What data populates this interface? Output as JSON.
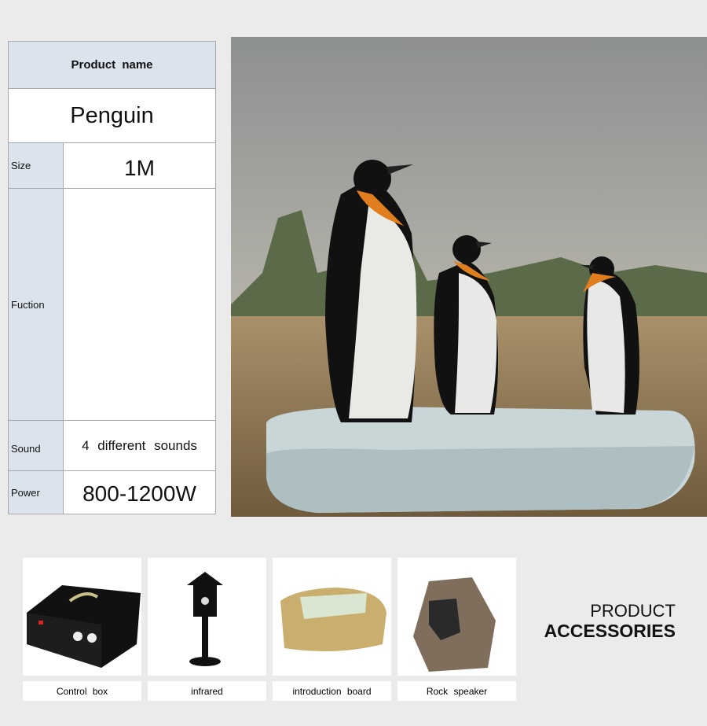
{
  "table": {
    "header": "Product name",
    "name": "Penguin",
    "rows": [
      {
        "label": "Size",
        "value": "1M"
      },
      {
        "label": "Fuction",
        "value": ""
      },
      {
        "label": "Sound",
        "value": "4 different sounds"
      },
      {
        "label": "Power",
        "value": "800-1200W"
      }
    ]
  },
  "accessories": {
    "title_line1": "PRODUCT",
    "title_line2": "ACCESSORIES",
    "items": [
      {
        "label": "Control box"
      },
      {
        "label": "infrared"
      },
      {
        "label": "introduction board"
      },
      {
        "label": "Rock speaker"
      }
    ]
  }
}
